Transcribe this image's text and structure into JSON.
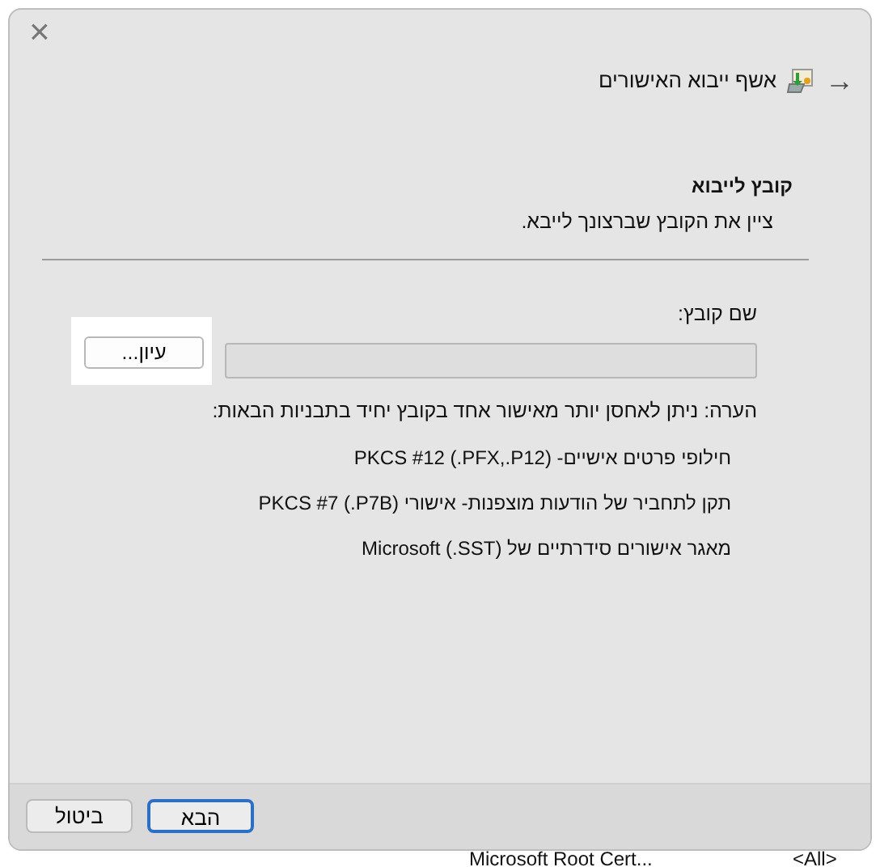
{
  "dialog": {
    "close_glyph": "×",
    "back_glyph": "→",
    "title": "אשף ייבוא האישורים"
  },
  "section": {
    "heading": "קובץ לייבוא",
    "subtitle": "ציין את הקובץ שברצונך לייבא."
  },
  "file_field": {
    "label": "שם קובץ:",
    "browse_button": "עיון..."
  },
  "note": {
    "intro": "הערה: ניתן לאחסן יותר מאישור אחד בקובץ יחיד בתבניות הבאות:",
    "formats": [
      "חילופי פרטים אישיים- PKCS #12 (.PFX,.P12)",
      "תקן לתחביר של הודעות מוצפנות- אישורי PKCS #7 (.P7B)",
      "מאגר אישורים סידרתיים של Microsoft (.SST)"
    ]
  },
  "buttons": [
    {
      "label": "הבא",
      "default": true
    },
    {
      "label": "ביטול",
      "default": false
    }
  ],
  "background_list": {
    "column_1": "<All>",
    "column_2": "Microsoft Root Cert..."
  }
}
